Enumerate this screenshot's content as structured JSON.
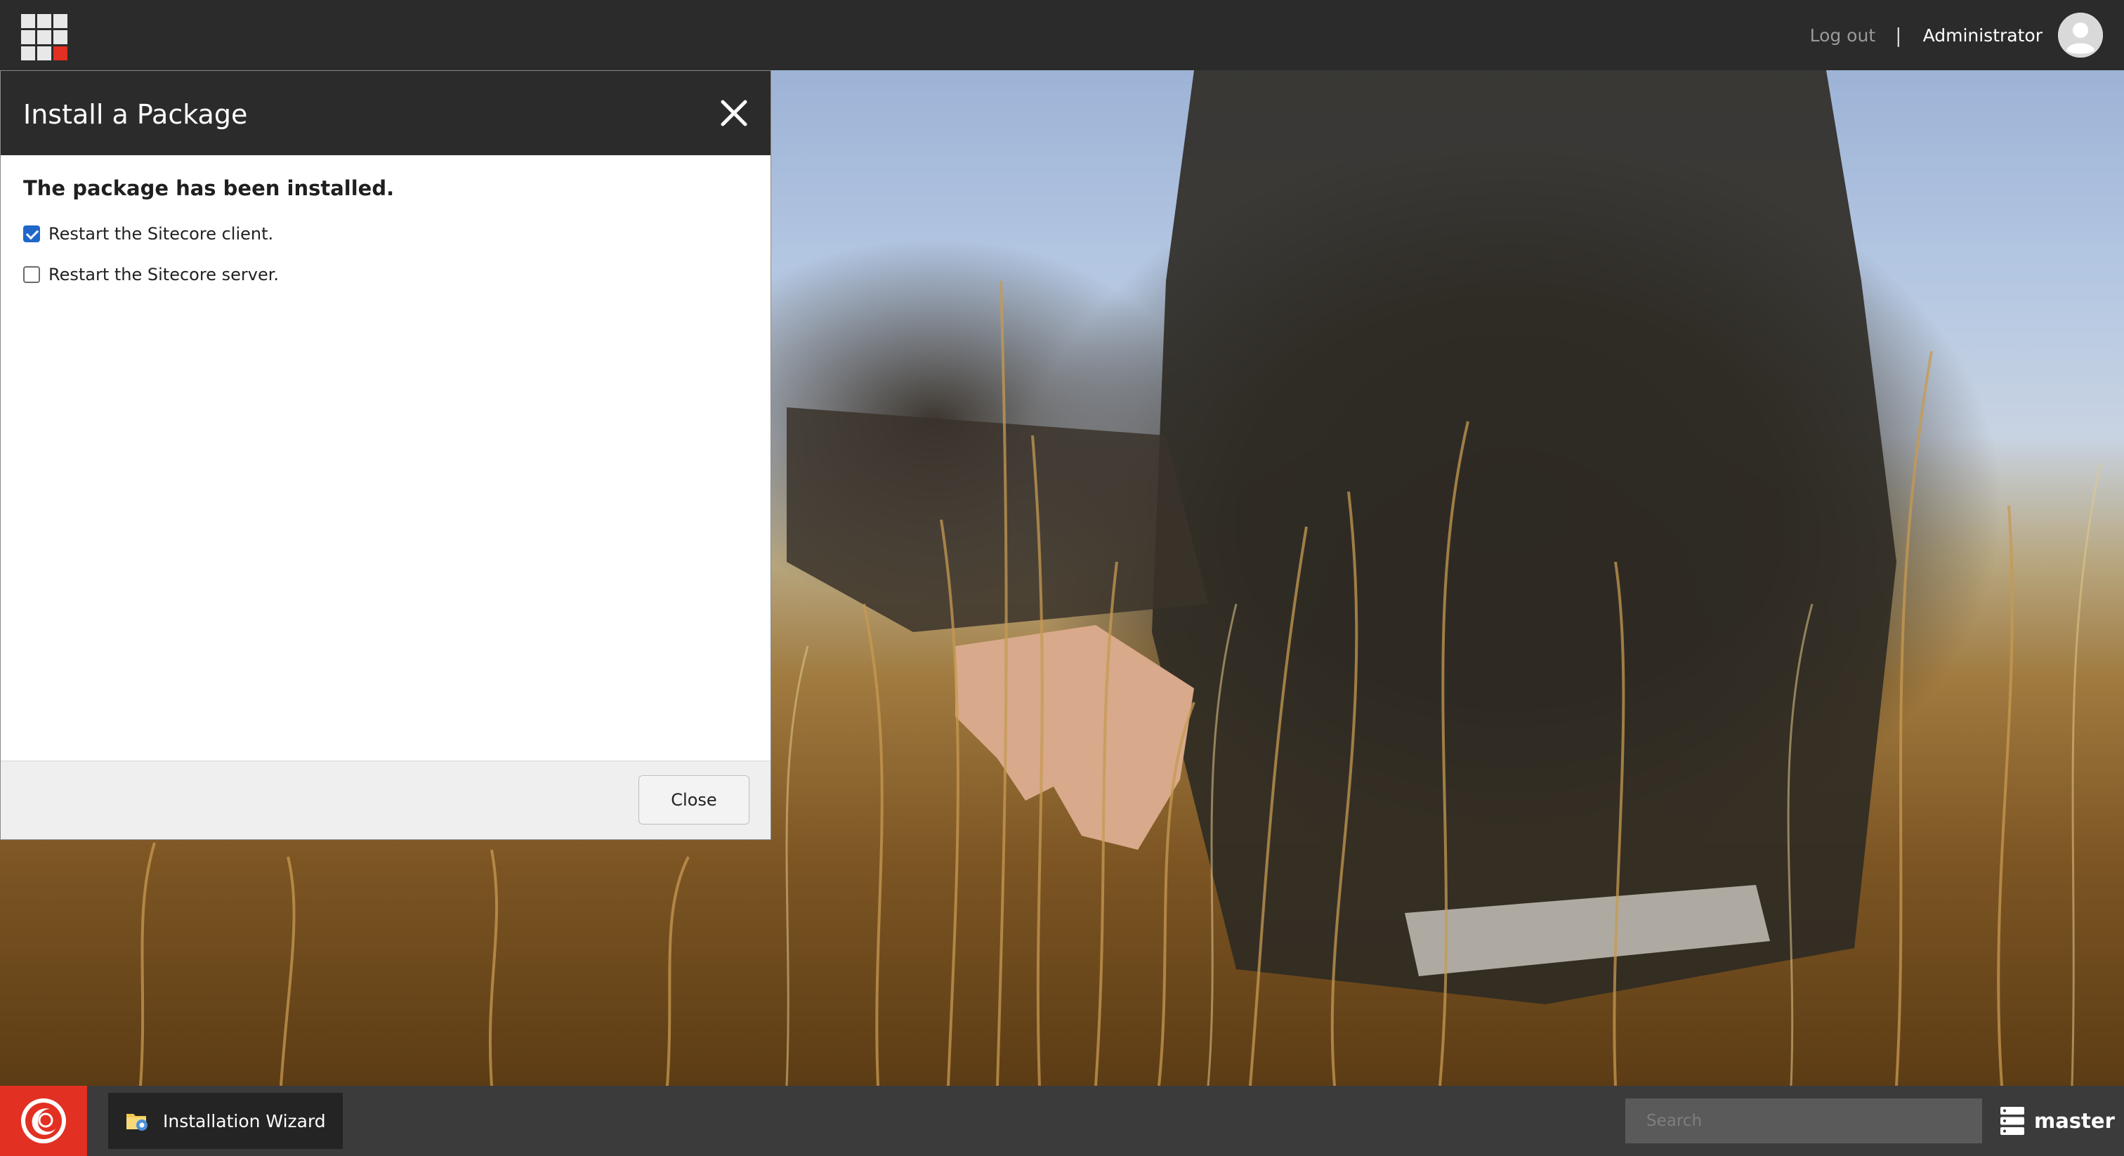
{
  "topbar": {
    "logout_label": "Log out",
    "separator": "|",
    "username": "Administrator",
    "launchpad_icon": "launchpad-grid-icon",
    "avatar_icon": "user-avatar-icon"
  },
  "dialog": {
    "title": "Install a Package",
    "close_icon": "close-icon",
    "message": "The package has been installed.",
    "options": [
      {
        "label": "Restart the Sitecore client.",
        "checked": true
      },
      {
        "label": "Restart the Sitecore server.",
        "checked": false
      }
    ],
    "close_button_label": "Close"
  },
  "taskbar": {
    "start_icon": "sitecore-logo-icon",
    "task_item_label": "Installation Wizard",
    "task_item_icon": "installation-wizard-icon",
    "search_placeholder": "Search",
    "database_label": "master",
    "database_icon": "database-icon"
  },
  "colors": {
    "topbar_bg": "#2b2b2b",
    "taskbar_bg": "#3b3b3b",
    "accent_red": "#e23022",
    "checkbox_blue": "#2167c9"
  }
}
